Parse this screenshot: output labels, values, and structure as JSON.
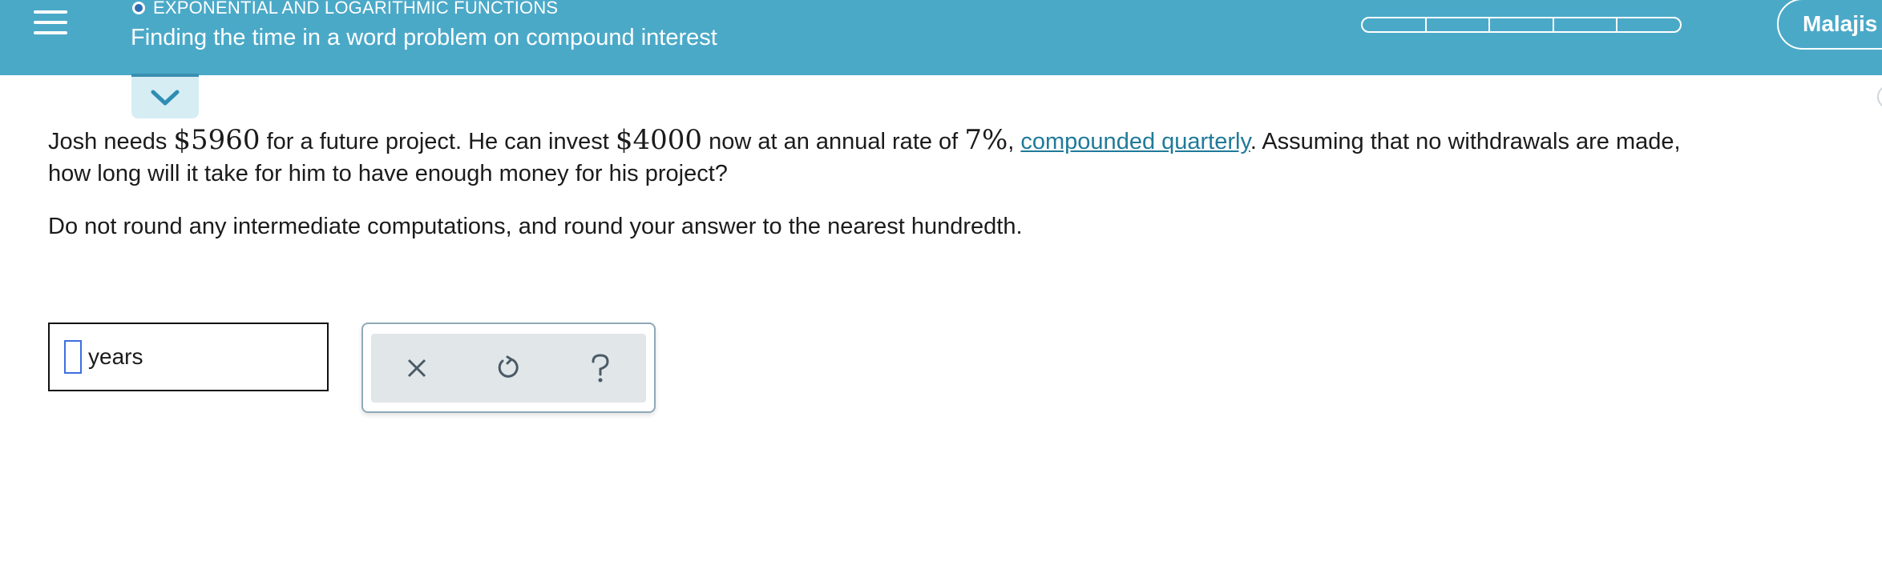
{
  "header": {
    "topic": "EXPONENTIAL AND LOGARITHMIC FUNCTIONS",
    "lesson_title": "Finding the time in a word problem on compound interest",
    "progress_segments": 5,
    "user_name": "Malajis",
    "background_color": "#4ba9c8"
  },
  "problem": {
    "text_1": "Josh needs ",
    "amount_needed": "$5960",
    "text_2": " for a future project. He can invest ",
    "amount_invest": "$4000",
    "text_3": " now at an annual rate of ",
    "rate": "7%",
    "text_4": ", ",
    "link_text": "compounded quarterly",
    "text_5": ". Assuming that no withdrawals are made,",
    "text_6": "how long will it take for him to have enough money for his project?",
    "instruction": "Do not round any intermediate computations, and round your answer to the nearest hundredth."
  },
  "answer": {
    "value": "",
    "unit": "years"
  },
  "tools": {
    "clear_icon": "x-icon",
    "undo_icon": "undo-icon",
    "help_icon": "question-icon"
  }
}
